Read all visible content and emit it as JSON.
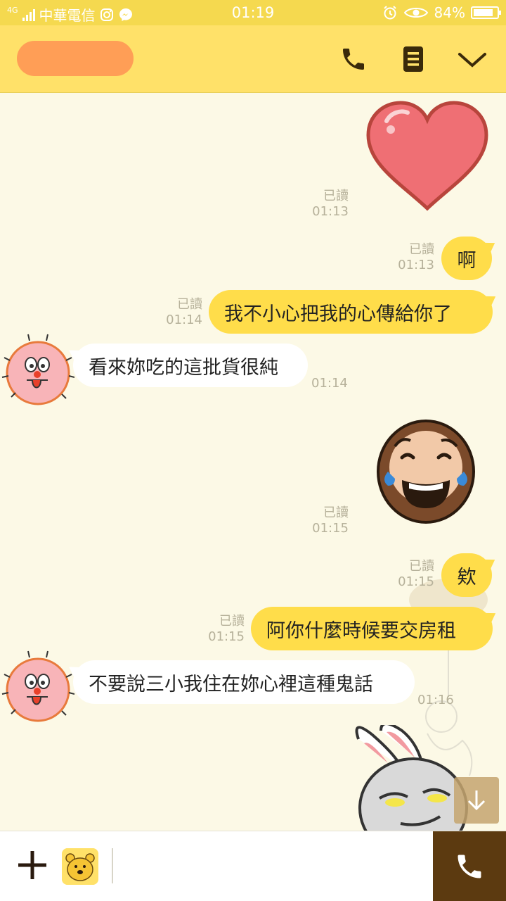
{
  "status_bar": {
    "network": "4G",
    "carrier": "中華電信",
    "time": "01:19",
    "battery": "84%",
    "battery_level": 0.84
  },
  "header": {
    "call_icon": "phone-icon",
    "menu_icon": "notes-icon",
    "dropdown_icon": "chevron-down-icon"
  },
  "messages": [
    {
      "type": "sticker",
      "from": "me",
      "sticker": "heart",
      "read": "已讀",
      "time": "01:13"
    },
    {
      "type": "text",
      "from": "me",
      "text": "啊",
      "read": "已讀",
      "time": "01:13"
    },
    {
      "type": "text",
      "from": "me",
      "text": "我不小心把我的心傳給你了",
      "read": "已讀",
      "time": "01:14"
    },
    {
      "type": "text",
      "from": "them",
      "text": "看來妳吃的這批貨很純",
      "time": "01:14"
    },
    {
      "type": "sticker",
      "from": "me",
      "sticker": "laughing-bearded-face",
      "read": "已讀",
      "time": "01:15"
    },
    {
      "type": "text",
      "from": "me",
      "text": "欸",
      "read": "已讀",
      "time": "01:15"
    },
    {
      "type": "text",
      "from": "me",
      "text": "阿你什麼時候要交房租",
      "read": "已讀",
      "time": "01:15"
    },
    {
      "type": "text",
      "from": "them",
      "text": "不要說三小我住在妳心裡這種鬼話",
      "time": "01:16"
    },
    {
      "type": "sticker",
      "from": "me",
      "sticker": "smirking-rabbit"
    }
  ],
  "input_bar": {
    "plus_icon": "plus-icon",
    "emoji_icon": "bear-sticker-icon",
    "call_icon": "phone-icon",
    "scroll_icon": "arrow-down-icon"
  }
}
